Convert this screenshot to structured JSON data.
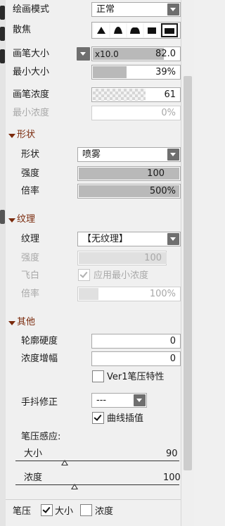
{
  "general": {
    "blend_label": "绘画模式",
    "blend_value": "正常",
    "blur_label": "散焦",
    "brush_size_label": "画笔大小",
    "brush_size_multiplier": "x10.0",
    "brush_size_value": "82.0",
    "brush_size_fill": 0.82,
    "min_size_label": "最小大小",
    "min_size_value": "39%",
    "min_size_fill": 0.39,
    "density_label": "画笔浓度",
    "density_value": "61",
    "density_fill": 0.61,
    "min_density_label": "最小浓度",
    "min_density_value": "0%"
  },
  "shape_section": {
    "title": "形状",
    "shape_label": "形状",
    "shape_value": "喷雾",
    "strength_label": "强度",
    "strength_value": "100",
    "strength_fill": 1.0,
    "rate_label": "倍率",
    "rate_value": "500%",
    "rate_fill": 1.0
  },
  "texture_section": {
    "title": "纹理",
    "texture_label": "纹理",
    "texture_value": "【无纹理】",
    "strength_label": "强度",
    "strength_value": "100",
    "flywhite_label": "飞白",
    "apply_min_density_label": "应用最小浓度",
    "apply_min_density_checked": true,
    "rate_label": "倍率",
    "rate_value": "100%"
  },
  "other_section": {
    "title": "其他",
    "edge_hardness_label": "轮廓硬度",
    "edge_hardness_value": "0",
    "density_gain_label": "浓度增幅",
    "density_gain_value": "0",
    "ver1_label": "Ver1笔压特性",
    "ver1_checked": false
  },
  "stabilizer": {
    "label": "手抖修正",
    "value": "---",
    "curve_interp_label": "曲线插值",
    "curve_interp_checked": true
  },
  "pressure": {
    "title": "笔压感应:",
    "size_label": "大小",
    "size_value": "90",
    "size_level": 0.3,
    "density_label": "浓度",
    "density_value": "100",
    "density_level": 0.36
  },
  "footer": {
    "label": "笔压",
    "size_label": "大小",
    "size_checked": true,
    "density_label": "浓度",
    "density_checked": false
  }
}
